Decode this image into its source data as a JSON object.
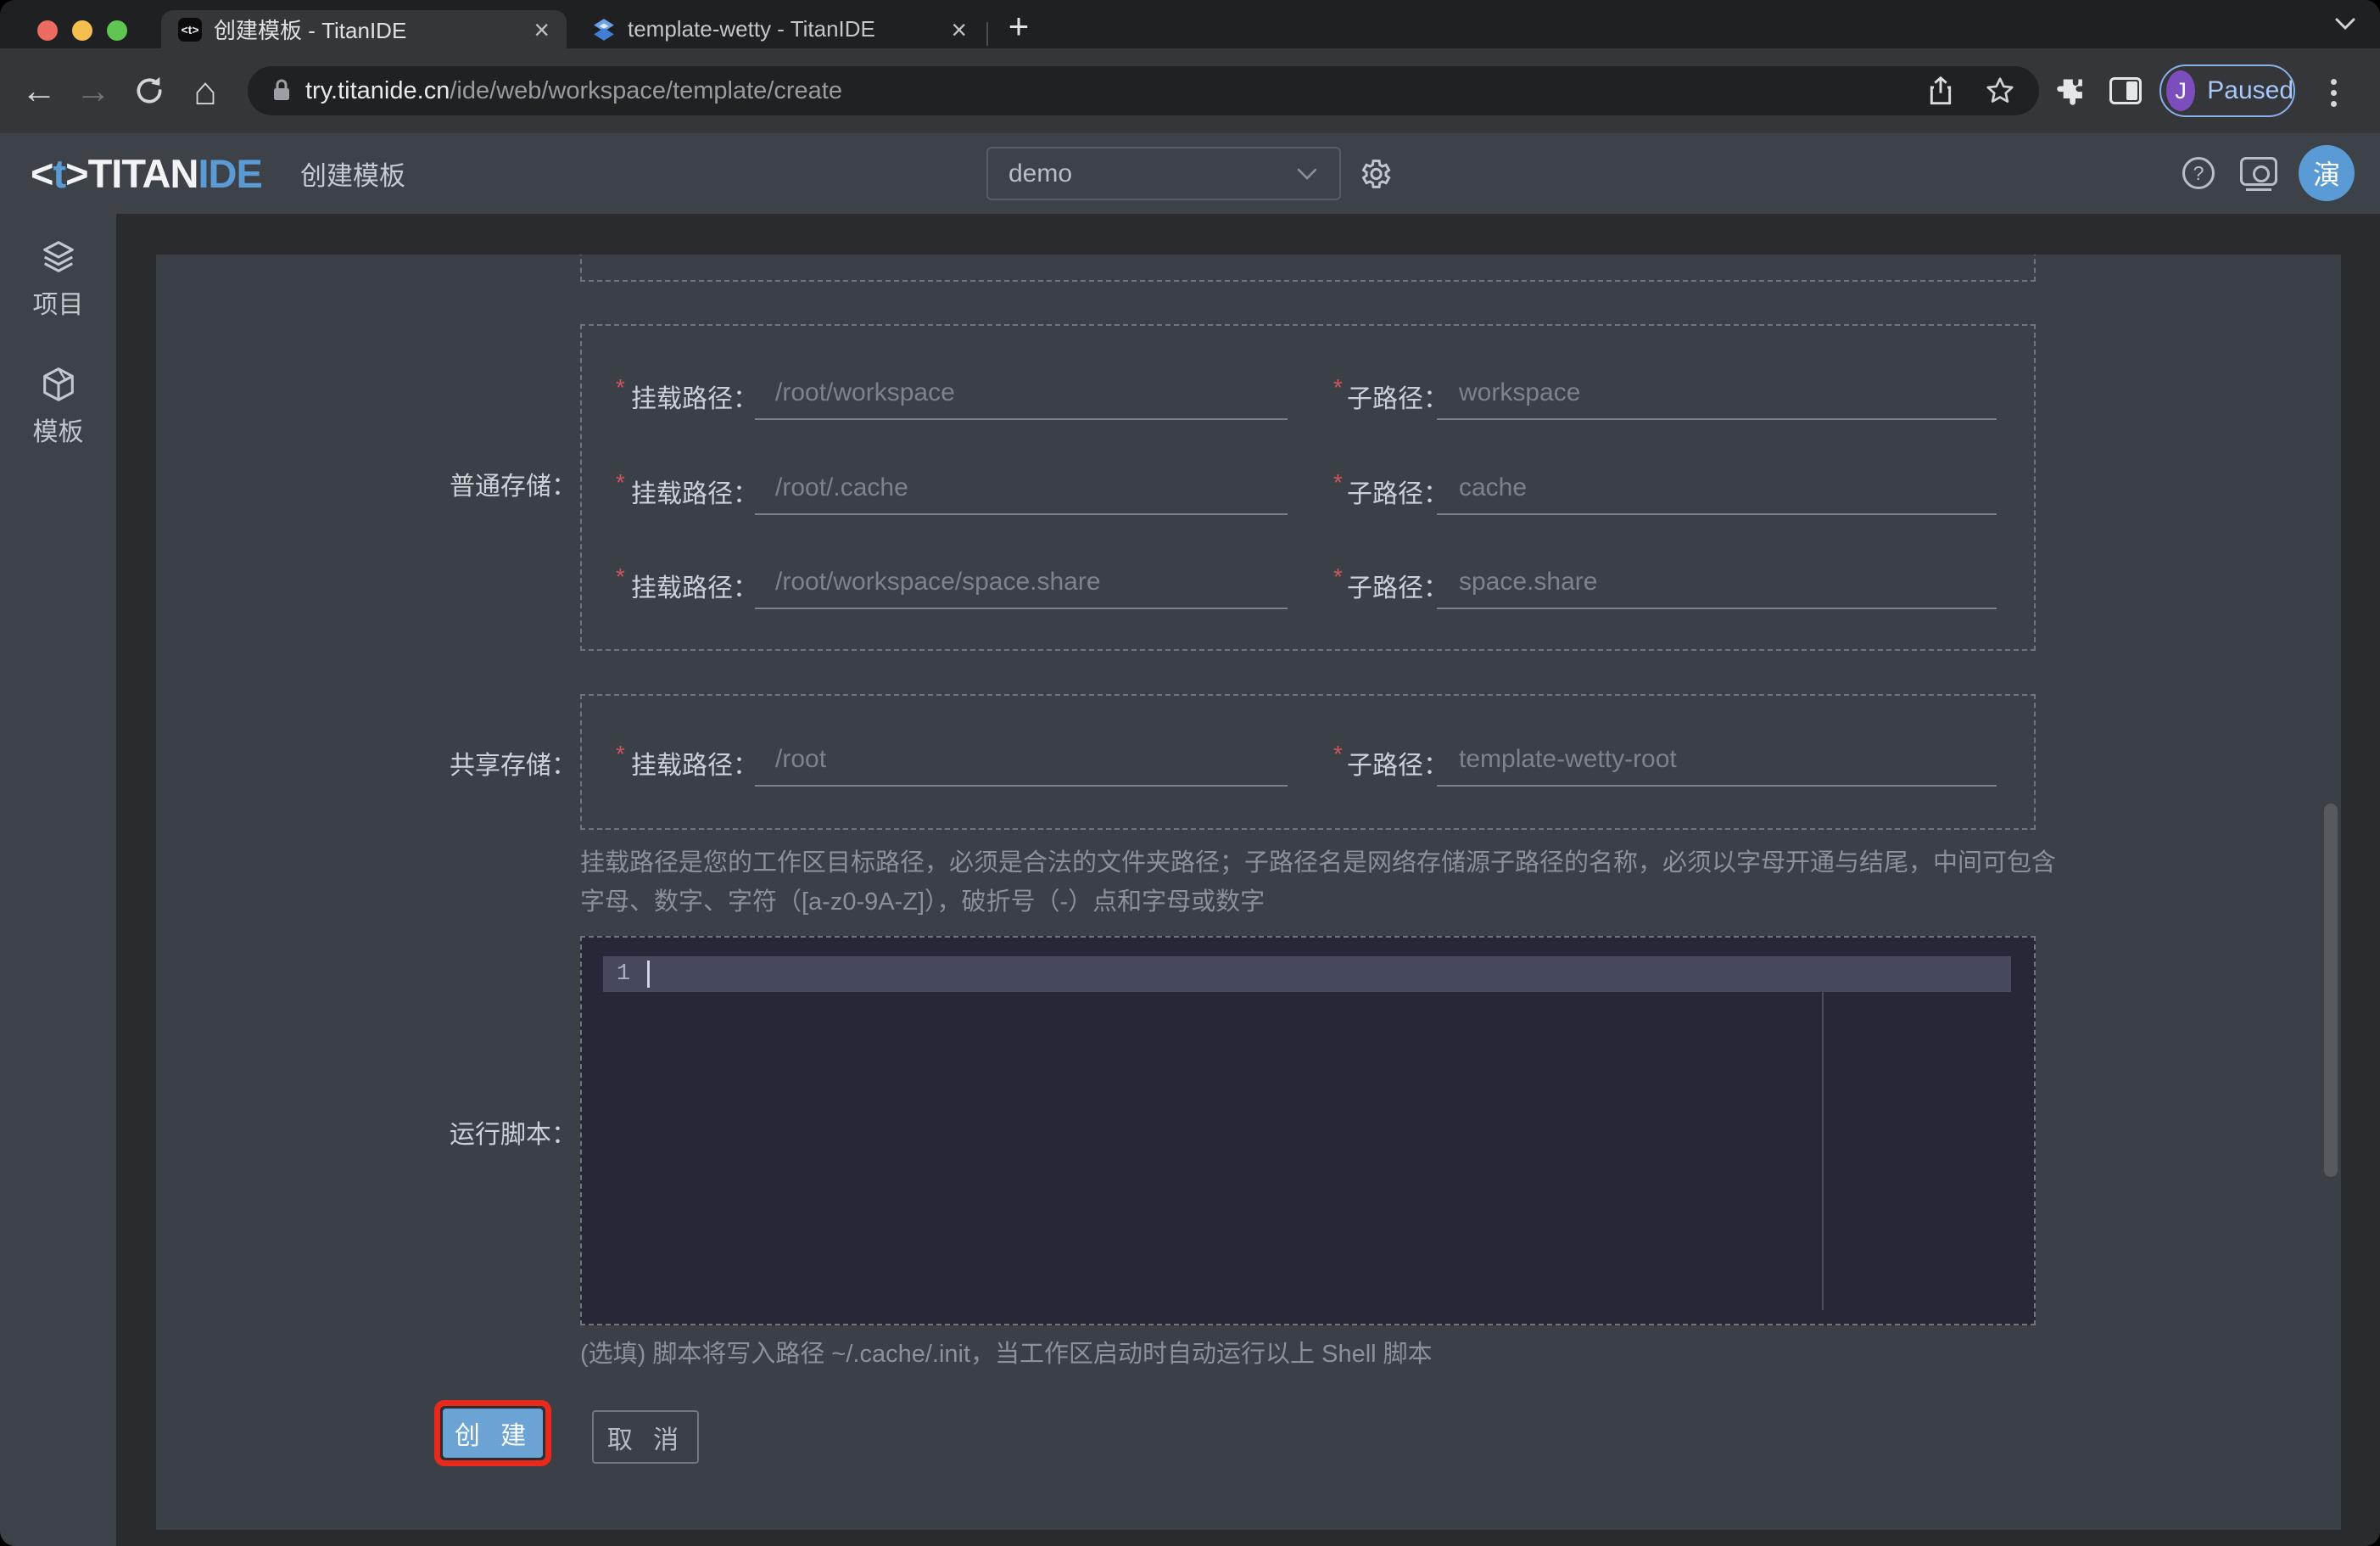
{
  "browser": {
    "tabs": [
      {
        "title": "创建模板 - TitanIDE",
        "favicon_glyph": "<t>"
      },
      {
        "title": "template-wetty - TitanIDE"
      }
    ],
    "close_tab_glyph": "×",
    "new_tab_glyph": "+",
    "nav": {
      "back_glyph": "←",
      "forward_glyph": "→",
      "home_glyph": "⌂"
    },
    "address": {
      "host": "try.titanide.cn",
      "path": "/ide/web/workspace/template/create"
    },
    "profile": {
      "initial": "J",
      "status": "Paused"
    }
  },
  "header": {
    "logo": {
      "open": "<",
      "t": "t",
      "close": ">",
      "primary": "TITAN",
      "accent": "IDE"
    },
    "page_title": "创建模板",
    "workspace_select": {
      "value": "demo"
    },
    "help_glyph": "?",
    "user_avatar": "演"
  },
  "sidebar": {
    "items": [
      {
        "label": "项目"
      },
      {
        "label": "模板"
      }
    ]
  },
  "form": {
    "required_marker": "*",
    "sections": [
      {
        "label": "普通存储：",
        "rows": [
          {
            "mount_label": "挂载路径：",
            "mount_placeholder": "/root/workspace",
            "sub_label": "子路径：",
            "sub_placeholder": "workspace"
          },
          {
            "mount_label": "挂载路径：",
            "mount_placeholder": "/root/.cache",
            "sub_label": "子路径：",
            "sub_placeholder": "cache"
          },
          {
            "mount_label": "挂载路径：",
            "mount_placeholder": "/root/workspace/space.share",
            "sub_label": "子路径：",
            "sub_placeholder": "space.share"
          }
        ]
      },
      {
        "label": "共享存储：",
        "rows": [
          {
            "mount_label": "挂载路径：",
            "mount_placeholder": "/root",
            "sub_label": "子路径：",
            "sub_placeholder": "template-wetty-root"
          }
        ]
      }
    ],
    "path_help": "挂载路径是您的工作区目标路径，必须是合法的文件夹路径；子路径名是网络存储源子路径的名称，必须以字母开通与结尾，中间可包含字母、数字、字符（[a-z0-9A-Z]），破折号（-）点和字母或数字",
    "script_label": "运行脚本：",
    "editor": {
      "line_number": "1"
    },
    "script_help": "(选填) 脚本将写入路径 ~/.cache/.init，当工作区启动时自动运行以上 Shell 脚本",
    "buttons": {
      "create": "创 建",
      "cancel": "取 消"
    }
  },
  "colors": {
    "accent_blue": "#5b9bd5",
    "create_button_blue": "#6ba3d4",
    "annotation_red": "#e8291c",
    "profile_purple": "#7c4dbc",
    "paused_blue": "#a9c7f7",
    "avatar_blue": "#5b9bd5"
  }
}
